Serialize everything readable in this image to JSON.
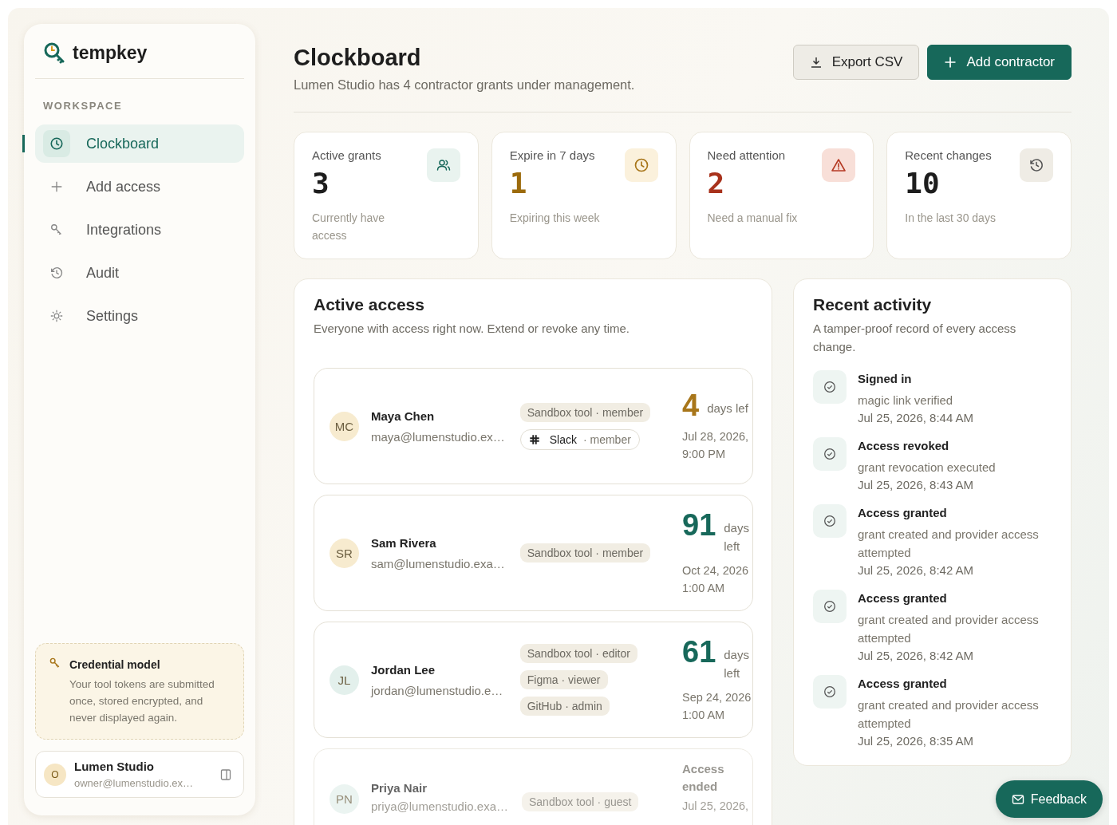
{
  "brand": {
    "name": "tempkey"
  },
  "sidebar": {
    "section": "WORKSPACE",
    "items": [
      {
        "label": "Clockboard",
        "selected": true
      },
      {
        "label": "Add access",
        "selected": false
      },
      {
        "label": "Integrations",
        "selected": false
      },
      {
        "label": "Audit",
        "selected": false
      },
      {
        "label": "Settings",
        "selected": false
      }
    ],
    "note": {
      "title": "Credential model",
      "text": "Your tool tokens are submitted once, stored encrypted, and never displayed again."
    },
    "account": {
      "initial": "O",
      "name": "Lumen Studio",
      "email": "owner@lumenstudio.ex…"
    }
  },
  "header": {
    "title": "Clockboard",
    "subtitle": "Lumen Studio has 4 contractor grants under management.",
    "buttons": [
      {
        "label": "Export CSV",
        "kind": "secondary"
      },
      {
        "label": "Add contractor",
        "kind": "primary"
      }
    ]
  },
  "stats": [
    {
      "label": "Active grants",
      "value": "3",
      "note": "Currently have access",
      "kind": "active"
    },
    {
      "label": "Expire in 7 days",
      "value": "1",
      "note": "Expiring this week",
      "kind": "expiring"
    },
    {
      "label": "Need attention",
      "value": "2",
      "note": "Need a manual fix",
      "kind": "attention"
    },
    {
      "label": "Recent changes",
      "value": "10",
      "note": "In the last 30 days",
      "kind": "changes"
    }
  ],
  "active_access": {
    "title": "Active access",
    "subtitle": "Everyone with access right now. Extend or revoke any time.",
    "grants": [
      {
        "initials": "MC",
        "color": "#f7ebcf",
        "name": "Maya Chen",
        "email": "maya@lumenstudio.ex…",
        "chips": [
          {
            "kind": "plain",
            "label": "Sandbox tool · member"
          },
          {
            "kind": "linked",
            "label": "Slack",
            "role": "· member"
          }
        ],
        "status": {
          "kind": "days",
          "urgent": true,
          "days": "4",
          "unit": "days lef",
          "date": "Jul 28, 2026,",
          "time": "9:00 PM"
        }
      },
      {
        "initials": "SR",
        "color": "#f7ebcf",
        "name": "Sam Rivera",
        "email": "sam@lumenstudio.exa…",
        "chips": [
          {
            "kind": "plain",
            "label": "Sandbox tool · member"
          }
        ],
        "status": {
          "kind": "days",
          "urgent": false,
          "days": "91",
          "unit": "days left",
          "date": "Oct 24, 2026",
          "time": "1:00 AM"
        }
      },
      {
        "initials": "JL",
        "color": "#e3f0ec",
        "name": "Jordan Lee",
        "email": "jordan@lumenstudio.e…",
        "chips": [
          {
            "kind": "plain",
            "label": "Sandbox tool · editor"
          },
          {
            "kind": "plain",
            "label": "Figma · viewer"
          },
          {
            "kind": "plain",
            "label": "GitHub · admin"
          }
        ],
        "status": {
          "kind": "days",
          "urgent": false,
          "days": "61",
          "unit": "days left",
          "date": "Sep 24, 2026",
          "time": "1:00 AM"
        }
      },
      {
        "initials": "PN",
        "color": "#e3f0ec",
        "name": "Priya Nair",
        "email": "priya@lumenstudio.exa…",
        "chips": [
          {
            "kind": "plain",
            "label": "Sandbox tool · guest"
          }
        ],
        "status": {
          "kind": "ended",
          "text": "Access ended",
          "date": "Jul 25, 2026,"
        }
      }
    ]
  },
  "recent_activity": {
    "title": "Recent activity",
    "subtitle": "A tamper-proof record of every access change.",
    "events": [
      {
        "title": "Signed in",
        "detail": "magic link verified",
        "time": "Jul 25, 2026, 8:44 AM"
      },
      {
        "title": "Access revoked",
        "detail": "grant revocation executed",
        "time": "Jul 25, 2026, 8:43 AM"
      },
      {
        "title": "Access granted",
        "detail": "grant created and provider access attempted",
        "time": "Jul 25, 2026, 8:42 AM"
      },
      {
        "title": "Access granted",
        "detail": "grant created and provider access attempted",
        "time": "Jul 25, 2026, 8:42 AM"
      },
      {
        "title": "Access granted",
        "detail": "grant created and provider access attempted",
        "time": "Jul 25, 2026, 8:35 AM"
      }
    ]
  },
  "feedback_button": {
    "label": "Feedback"
  }
}
